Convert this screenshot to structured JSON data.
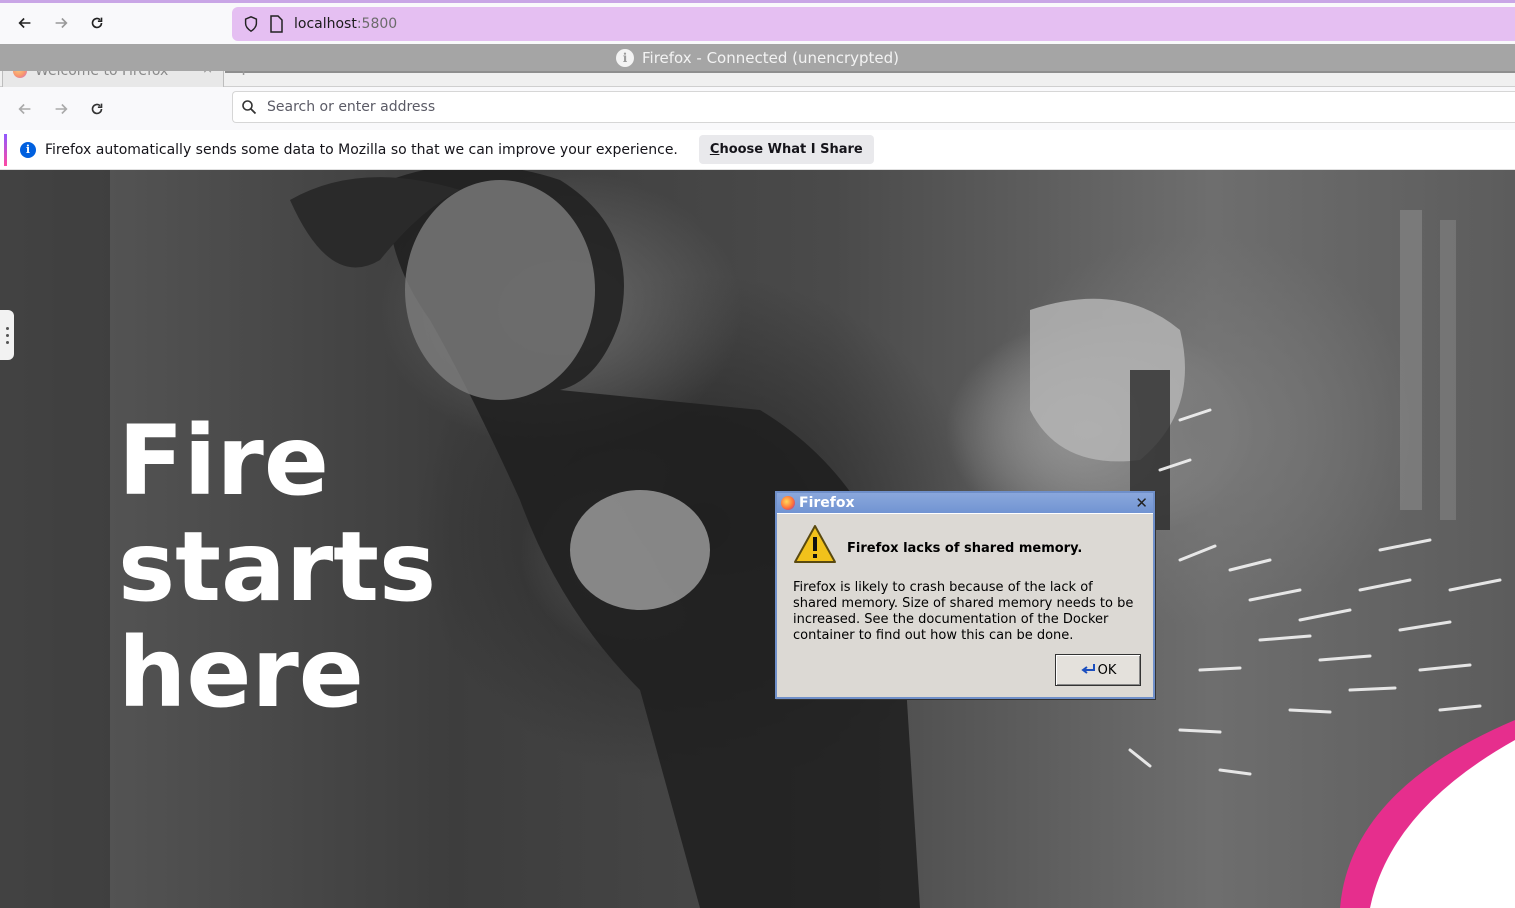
{
  "outer_browser": {
    "url_host": "localhost",
    "url_port": ":5800"
  },
  "remote_window": {
    "title": "Firefox - Connected (unencrypted)"
  },
  "inner_browser": {
    "tab_label": "Welcome to Firefox",
    "tab_close": "×",
    "new_tab": "+",
    "address_placeholder": "Search or enter address"
  },
  "notification": {
    "message": "Firefox automatically sends some data to Mozilla so that we can improve your experience.",
    "button_accesskey": "C",
    "button_rest": "hoose What I Share"
  },
  "page": {
    "hero_title": "Fire\nstarts\nhere"
  },
  "dialog": {
    "title": "Firefox",
    "close": "✕",
    "heading": "Firefox lacks of shared memory.",
    "body": "Firefox is likely to crash because of the lack of\nshared memory.  Size of shared memory needs to be\nincreased.  See the documentation of the Docker\ncontainer to find out how this can be done.",
    "ok_label": "OK"
  },
  "colors": {
    "outer_url_bg": "#e5bff2",
    "dialog_title_bg": "#7194d2",
    "info_blue": "#0060df",
    "swoosh_pink": "#e62e8d"
  }
}
